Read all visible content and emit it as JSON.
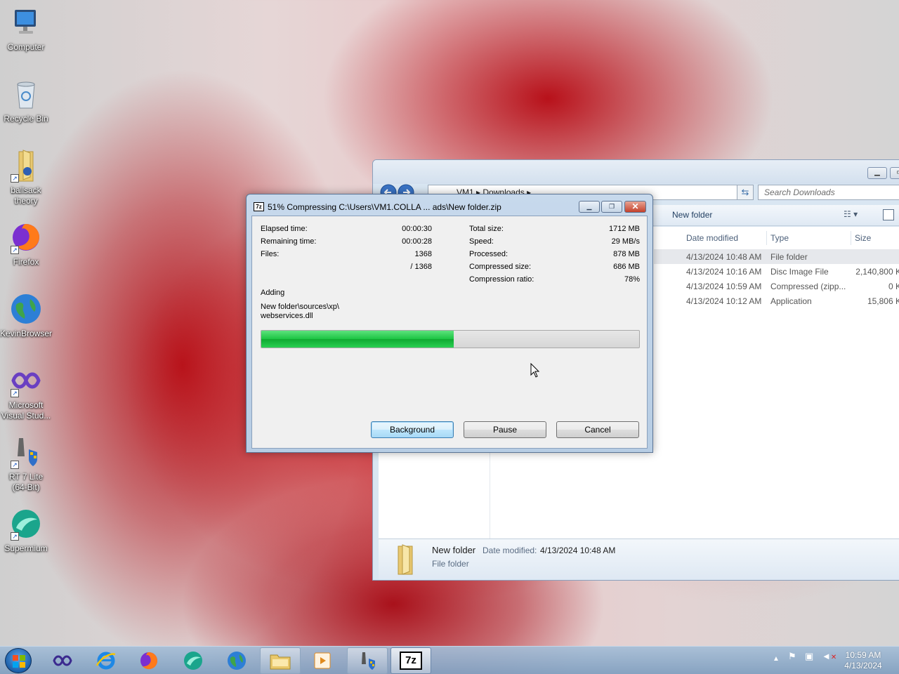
{
  "desktop": {
    "icons": [
      {
        "label": "Computer"
      },
      {
        "label": "Recycle Bin"
      },
      {
        "label": "ballsack theory"
      },
      {
        "label": "Firefox"
      },
      {
        "label": "KevinBrowser"
      },
      {
        "label": "Microsoft Visual Stud..."
      },
      {
        "label": "RT 7 Lite (64-Bit)"
      },
      {
        "label": "Supermium"
      }
    ]
  },
  "explorer": {
    "address": [
      "VM1",
      "Downloads"
    ],
    "search_placeholder": "Search Downloads",
    "toolbar": {
      "new_folder": "New folder"
    },
    "columns": {
      "date_modified": "Date modified",
      "type": "Type",
      "size": "Size"
    },
    "rows": [
      {
        "date": "4/13/2024 10:48 AM",
        "type": "File folder",
        "size": ""
      },
      {
        "date": "4/13/2024 10:16 AM",
        "type": "Disc Image File",
        "size": "2,140,800 KB"
      },
      {
        "date": "4/13/2024 10:59 AM",
        "type": "Compressed (zipp...",
        "size": "0 KB"
      },
      {
        "date": "4/13/2024 10:12 AM",
        "type": "Application",
        "size": "15,806 KB"
      }
    ],
    "details": {
      "name": "New folder",
      "modified_label": "Date modified:",
      "modified_value": "4/13/2024 10:48 AM",
      "type": "File folder"
    }
  },
  "dialog": {
    "icon_text": "7z",
    "title": "51% Compressing C:\\Users\\VM1.COLLA ... ads\\New folder.zip",
    "progress_fraction": 0.51,
    "stats_left": {
      "elapsed_label": "Elapsed time:",
      "elapsed_value": "00:00:30",
      "remaining_label": "Remaining time:",
      "remaining_value": "00:00:28",
      "files_label": "Files:",
      "files_value": "1368",
      "files_total": "/ 1368"
    },
    "stats_right": {
      "total_label": "Total size:",
      "total_value": "1712 MB",
      "speed_label": "Speed:",
      "speed_value": "29 MB/s",
      "processed_label": "Processed:",
      "processed_value": "878 MB",
      "compressed_label": "Compressed size:",
      "compressed_value": "686 MB",
      "ratio_label": "Compression ratio:",
      "ratio_value": "78%"
    },
    "action_label": "Adding",
    "current_file_line1": "New folder\\sources\\xp\\",
    "current_file_line2": "webservices.dll",
    "buttons": {
      "background": "Background",
      "pause": "Pause",
      "cancel": "Cancel"
    }
  },
  "taskbar": {
    "clock_time": "10:59 AM",
    "clock_date": "4/13/2024",
    "items": [
      "visual-studio-icon",
      "internet-explorer-icon",
      "firefox-icon",
      "supermium-icon",
      "kevinbrowser-icon",
      "file-explorer-icon",
      "media-player-icon",
      "rt7lite-icon",
      "7zip-icon"
    ]
  }
}
